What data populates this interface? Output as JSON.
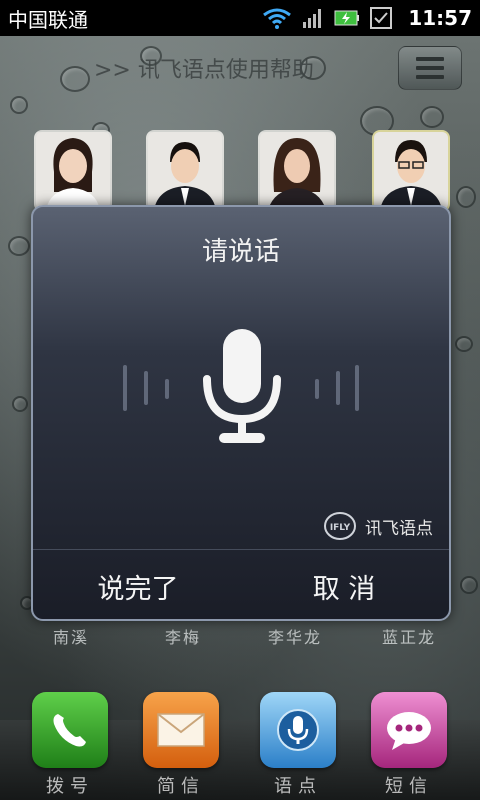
{
  "status_bar": {
    "carrier": "中国联通",
    "time": "11:57",
    "icons": [
      "wifi-icon",
      "signal-icon",
      "battery-charging-icon",
      "notification-check-icon"
    ]
  },
  "header": {
    "help_link": ">> 讯飞语点使用帮助",
    "menu_icon": "menu-icon"
  },
  "contacts": [
    {
      "name": "南溪"
    },
    {
      "name": "李梅"
    },
    {
      "name": "李华龙"
    },
    {
      "name": "蓝正龙"
    }
  ],
  "dock": [
    {
      "label": "拨号",
      "icon": "phone-icon",
      "color": "#2f9a2a"
    },
    {
      "label": "简信",
      "icon": "envelope-icon",
      "color": "#e27a1a"
    },
    {
      "label": "语点",
      "icon": "microphone-icon",
      "color": "#2b7fc8"
    },
    {
      "label": "短信",
      "icon": "chat-bubble-icon",
      "color": "#c33c9a"
    }
  ],
  "dialog": {
    "title": "请说话",
    "brand": "讯飞语点",
    "brand_logo_text": "IFLY",
    "done_label": "说完了",
    "cancel_label": "取 消"
  },
  "colors": {
    "dialog_border": "#8c98ac",
    "dialog_top": "#5a6272",
    "dialog_bottom": "#1a1d27"
  }
}
